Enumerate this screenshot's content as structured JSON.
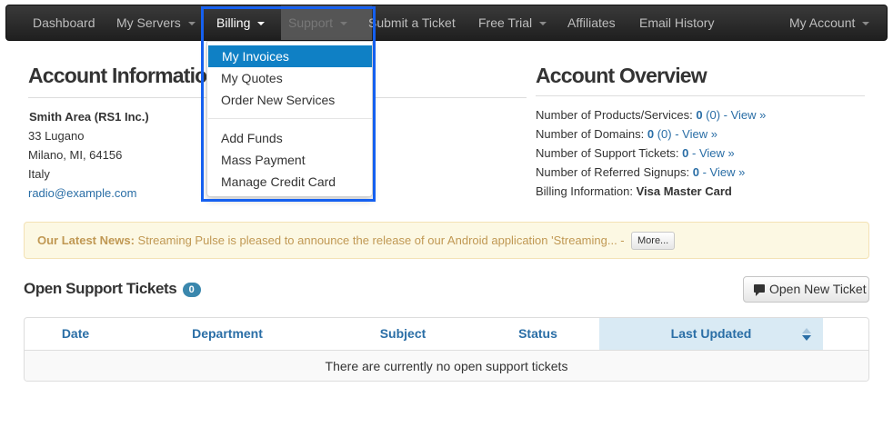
{
  "nav": {
    "dashboard": "Dashboard",
    "my_servers": "My Servers",
    "billing": "Billing",
    "support": "Support",
    "submit_ticket": "Submit a Ticket",
    "free_trial": "Free Trial",
    "affiliates": "Affiliates",
    "email_history": "Email History",
    "my_account": "My Account"
  },
  "billing_menu": {
    "items": [
      "My Invoices",
      "My Quotes",
      "Order New Services",
      "Add Funds",
      "Mass Payment",
      "Manage Credit Card"
    ],
    "active": "My Invoices"
  },
  "account_info": {
    "title": "Account Information",
    "name": "Smith Area (RS1 Inc.)",
    "address1": "33 Lugano",
    "address2": "Milano, MI, 64156",
    "country": "Italy",
    "email": "radio@example.com"
  },
  "account_overview": {
    "title": "Account Overview",
    "products_label": "Number of Products/Services:",
    "products_count": "0",
    "products_extra": "(0) - View »",
    "domains_label": "Number of Domains:",
    "domains_count": "0",
    "domains_extra": "(0) - View »",
    "tickets_label": "Number of Support Tickets:",
    "tickets_count": "0",
    "tickets_extra": "- View »",
    "referred_label": "Number of Referred Signups:",
    "referred_count": "0",
    "referred_extra": "- View »",
    "billing_label": "Billing Information:",
    "billing_value": "Visa Master Card"
  },
  "news": {
    "title": "Our Latest News:",
    "text": "Streaming Pulse is pleased to announce the release of our Android application 'Streaming... -",
    "more": "More..."
  },
  "tickets": {
    "title": "Open Support Tickets",
    "count": "0",
    "open_button": "Open New Ticket",
    "columns": [
      "Date",
      "Department",
      "Subject",
      "Status",
      "Last Updated"
    ],
    "empty_message": "There are currently no open support tickets"
  },
  "colors": {
    "accent": "#0f80c5",
    "link": "#2a6ea6",
    "highlight_box": "#1560f0",
    "news_text": "#c09853"
  },
  "icons": {
    "open_ticket": "comment-icon",
    "sort": "sort-icon"
  }
}
